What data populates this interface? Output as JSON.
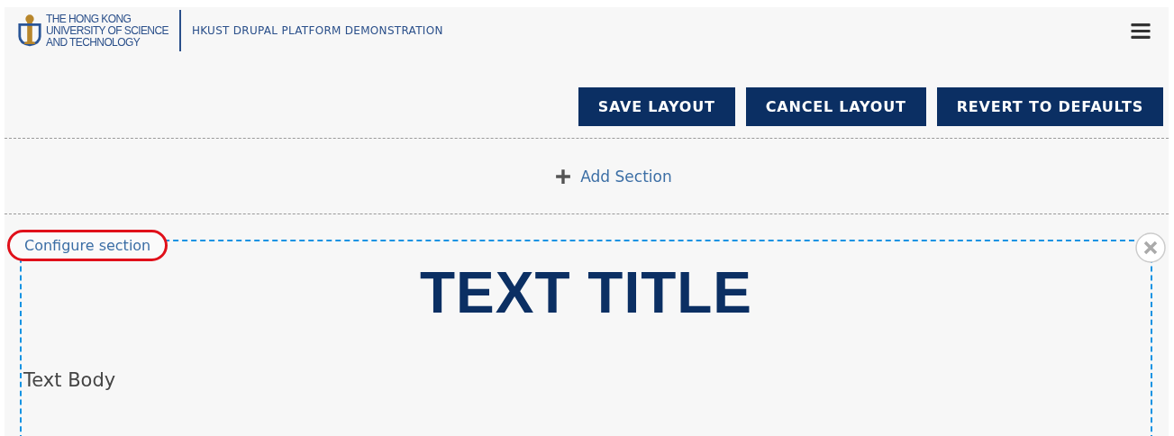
{
  "header": {
    "logo_lines": [
      "THE HONG KONG",
      "UNIVERSITY OF SCIENCE",
      "AND TECHNOLOGY"
    ],
    "site_name": "HKUST DRUPAL PLATFORM DEMONSTRATION"
  },
  "toolbar": {
    "buttons": [
      "SAVE LAYOUT",
      "CANCEL LAYOUT",
      "REVERT TO DEFAULTS"
    ]
  },
  "add_section": {
    "label": "Add Section"
  },
  "section": {
    "configure_link": "Configure section",
    "highlighted": true,
    "title": "TEXT TITLE",
    "body": "Text Body"
  }
}
